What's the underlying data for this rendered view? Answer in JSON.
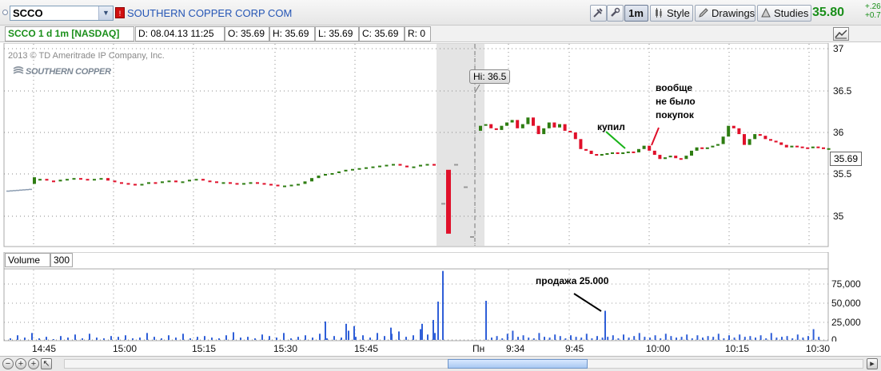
{
  "toolbar": {
    "symbol": "SCCO",
    "alert_badge": "!",
    "company": "SOUTHERN COPPER CORP COM",
    "interval_button": "1m",
    "style_button": "Style",
    "drawings_button": "Drawings",
    "studies_button": "Studies",
    "last_price": "35.80",
    "change_1": "+.26",
    "change_2": "+0.7"
  },
  "infobar": {
    "symbol_desc": "SCCO 1 d 1m [NASDAQ]",
    "date": "D: 08.04.13 11:25",
    "open": "O: 35.69",
    "high": "H: 35.69",
    "low": "L: 35.69",
    "close": "C: 35.69",
    "range": "R: 0"
  },
  "chart": {
    "copyright": "2013 © TD Ameritrade IP Company, Inc.",
    "logo_text": "SOUTHERN COPPER",
    "hi_label": "Hi: 36.5",
    "last_price_tag": "35.69",
    "price_axis": [
      "37",
      "36.5",
      "36",
      "35.5",
      "35"
    ],
    "annotations": {
      "bought": "купил",
      "no_buys_1": "вообще",
      "no_buys_2": "не было",
      "no_buys_3": "покупок",
      "sale": "продажа 25.000"
    },
    "colors": {
      "up": "#2e7d12",
      "down": "#e0102a",
      "volume": "#2f5fd8",
      "session_band": "#e4e4e4"
    }
  },
  "volume": {
    "label": "Volume",
    "period": "300",
    "axis": [
      "75,000",
      "50,000",
      "25,000",
      "0"
    ]
  },
  "time_axis": [
    "14:45",
    "15:00",
    "15:15",
    "15:30",
    "15:45",
    "Пн",
    "9:34",
    "9:45",
    "10:00",
    "10:15",
    "10:30"
  ]
}
